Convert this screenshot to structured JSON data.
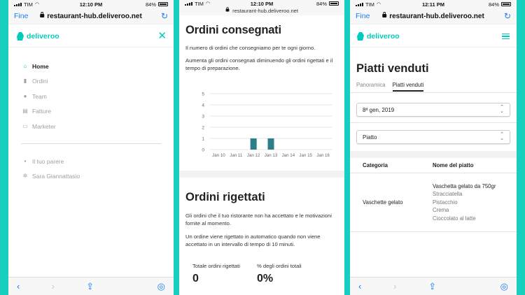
{
  "status_bars": [
    {
      "carrier": "TIM",
      "time": "12:10 PM",
      "battery": "84%"
    },
    {
      "carrier": "TIM",
      "time": "12:10 PM",
      "battery": "84%"
    },
    {
      "carrier": "TIM",
      "time": "12:11 PM",
      "battery": "84%"
    }
  ],
  "browser": {
    "done_label": "Fine",
    "url": "restaurant-hub.deliveroo.net"
  },
  "brand": {
    "name": "deliveroo",
    "accent": "#00ccbc"
  },
  "menu": {
    "items": [
      {
        "label": "Home",
        "icon": "home-icon",
        "active": true
      },
      {
        "label": "Ordini",
        "icon": "bar-chart-icon",
        "active": false
      },
      {
        "label": "Team",
        "icon": "people-icon",
        "active": false
      },
      {
        "label": "Fatture",
        "icon": "document-icon",
        "active": false
      },
      {
        "label": "Marketer",
        "icon": "marketer-icon",
        "active": false
      }
    ],
    "secondary": [
      {
        "label": "Il tuo parere",
        "icon": "feedback-icon"
      },
      {
        "label": "Sara Giannattasio",
        "icon": "gear-icon"
      }
    ]
  },
  "delivered": {
    "title": "Ordini consegnati",
    "desc1": "Il numero di ordini che consegniamo per te ogni giorno.",
    "desc2": "Aumenta gli ordini consegnati diminuendo gli ordini rigettati e il tempo di preparazione."
  },
  "chart_data": {
    "type": "bar",
    "categories": [
      "Jan 10",
      "Jan 11",
      "Jan 12",
      "Jan 13",
      "Jan 14",
      "Jan 15",
      "Jan 16"
    ],
    "values": [
      0,
      0,
      1,
      1,
      0,
      0,
      0
    ],
    "ylim": [
      0,
      5
    ],
    "yticks": [
      0,
      1,
      2,
      3,
      4,
      5
    ],
    "bar_color": "#2b7f86",
    "grid": true
  },
  "rejected": {
    "title": "Ordini rigettati",
    "desc1": "Gli ordini che il tuo ristorante non ha accettato e le motivazioni fornite al momento.",
    "desc2": "Un ordine viene rigettato in automatico quando non viene accettato in un intervallo di tempo di 10 minuti.",
    "stats": [
      {
        "label": "Totale ordini rigettati",
        "value": "0"
      },
      {
        "label": "% degli ordini totali",
        "value": "0%"
      }
    ]
  },
  "sold": {
    "title": "Piatti venduti",
    "tabs": [
      {
        "label": "Panoramica",
        "active": false
      },
      {
        "label": "Piatti venduti",
        "active": true
      }
    ],
    "date_select": "8ª gen, 2019",
    "type_select": "Piatto",
    "table": {
      "headers": [
        "Categoria",
        "Nome del piatto"
      ],
      "category": "Vaschette gelato",
      "dish": "Vaschetta gelato da 750gr",
      "options": [
        "Stracciatella",
        "Pistacchio",
        "Crema",
        "Cioccolato al latte"
      ]
    }
  }
}
